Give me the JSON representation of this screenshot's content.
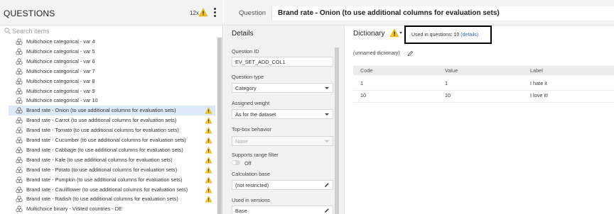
{
  "left_panel": {
    "title": "QUESTIONS",
    "warning_count": "12x",
    "search_placeholder": "Search items",
    "items": [
      {
        "label": "Multichoice categorical - var 4",
        "warning": false,
        "selected": false
      },
      {
        "label": "Multichoice categorical - var 5",
        "warning": false,
        "selected": false
      },
      {
        "label": "Multichoice categorical - var 6",
        "warning": false,
        "selected": false
      },
      {
        "label": "Multichoice categorical - var 7",
        "warning": false,
        "selected": false
      },
      {
        "label": "Multichoice categorical - var 8",
        "warning": false,
        "selected": false
      },
      {
        "label": "Multichoice categorical - var 9",
        "warning": false,
        "selected": false
      },
      {
        "label": "Multichoice categorical - var 10",
        "warning": false,
        "selected": false
      },
      {
        "label": "Brand rate - Onion (to use additional columns for evaluation sets)",
        "warning": true,
        "selected": true
      },
      {
        "label": "Brand rate - Carrot (to use additional columns for evaluation sets)",
        "warning": true,
        "selected": false
      },
      {
        "label": "Brand rate - Tomato (to use additional columns for evaluation sets)",
        "warning": true,
        "selected": false
      },
      {
        "label": "Brand rate - Cucumber (to use additional columns for evaluation sets)",
        "warning": true,
        "selected": false
      },
      {
        "label": "Brand rate - Cabbage (to use additional columns for evaluation sets)",
        "warning": true,
        "selected": false
      },
      {
        "label": "Brand rate - Kale (to use additional columns for evaluation sets)",
        "warning": true,
        "selected": false
      },
      {
        "label": "Brand rate - Potato (to use additional columns for evaluation sets)",
        "warning": true,
        "selected": false
      },
      {
        "label": "Brand rate - Pumpkin (to use additional columns for evaluation sets)",
        "warning": true,
        "selected": false
      },
      {
        "label": "Brand rate - Cauliflower (to use additional columns for evaluation sets)",
        "warning": true,
        "selected": false
      },
      {
        "label": "Brand rate - Radish (to use additional columns for evaluation sets)",
        "warning": true,
        "selected": false
      },
      {
        "label": "Multichoice binary - Visited countries - DE",
        "warning": false,
        "selected": false
      }
    ]
  },
  "question_bar": {
    "caption": "Question",
    "title": "Brand rate - Onion (to use additional columns for evaluation sets)"
  },
  "details": {
    "title": "Details",
    "question_id_label": "Question ID",
    "question_id_value": "EV_SET_ADD_COL1",
    "question_type_label": "Question type",
    "question_type_value": "Category",
    "assigned_weight_label": "Assigned weight",
    "assigned_weight_value": "As for the dataset",
    "topbox_label": "Top-box behavior",
    "topbox_value": "None",
    "range_filter_label": "Supports range filter",
    "range_filter_state": "Off",
    "calc_base_label": "Calculation base",
    "calc_base_value": "(not restricted)",
    "used_versions_label": "Used in versions",
    "used_versions_value": "Base"
  },
  "dictionary": {
    "title": "Dictionary",
    "used_prefix": "Used in questions: 10",
    "details_link": "(details)",
    "name": "(unnamed dictionary)",
    "columns": [
      "Code",
      "Value",
      "Label"
    ],
    "rows": [
      [
        "1",
        "1",
        "I hate it"
      ],
      [
        "10",
        "10",
        "I love it!"
      ]
    ]
  },
  "colors": {
    "warning": "#f5c518",
    "selected_row": "#dde9f7",
    "link": "#2f6fb3"
  }
}
